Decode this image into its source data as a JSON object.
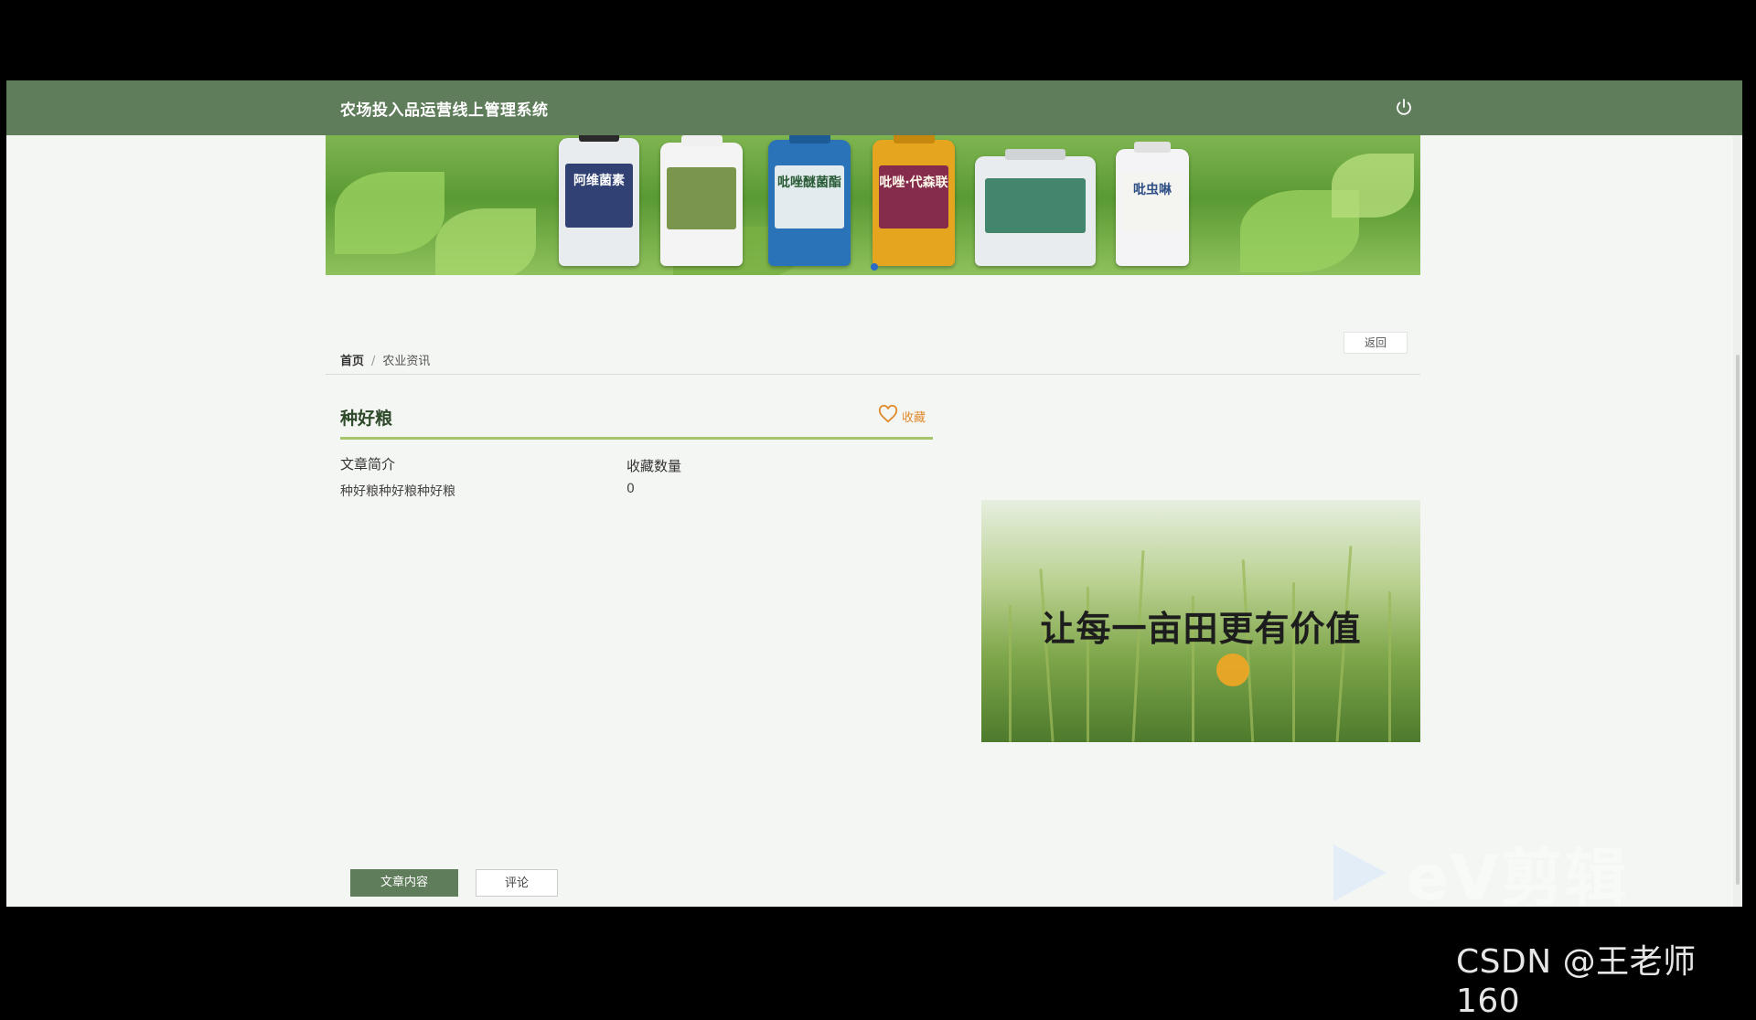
{
  "header": {
    "app_title": "农场投入品运营线上管理系统",
    "logout_icon": "power-icon"
  },
  "banner": {
    "bottle_labels": [
      "阿维菌素",
      "",
      "吡唑醚菌酯",
      "吡唑·代森联",
      "",
      "吡虫啉"
    ]
  },
  "toolbar": {
    "back_label": "返回"
  },
  "breadcrumb": {
    "home": "首页",
    "separator": "/",
    "current": "农业资讯"
  },
  "article": {
    "title": "种好粮",
    "favorite_label": "收藏",
    "favorite_icon": "heart-icon",
    "intro_label": "文章简介",
    "intro_text": "种好粮种好粮种好粮",
    "count_label": "收藏数量",
    "count_value": "0"
  },
  "side_image": {
    "slogan": "让每一亩田更有价值"
  },
  "tabs": [
    {
      "label": "文章内容",
      "active": true
    },
    {
      "label": "评论",
      "active": false
    }
  ],
  "watermarks": {
    "ev": "eV剪辑",
    "csdn": "CSDN @王老师160"
  },
  "colors": {
    "header_bg": "#5f7d5b",
    "accent_orange": "#e08a2b",
    "underline_green": "#a6c46a"
  }
}
